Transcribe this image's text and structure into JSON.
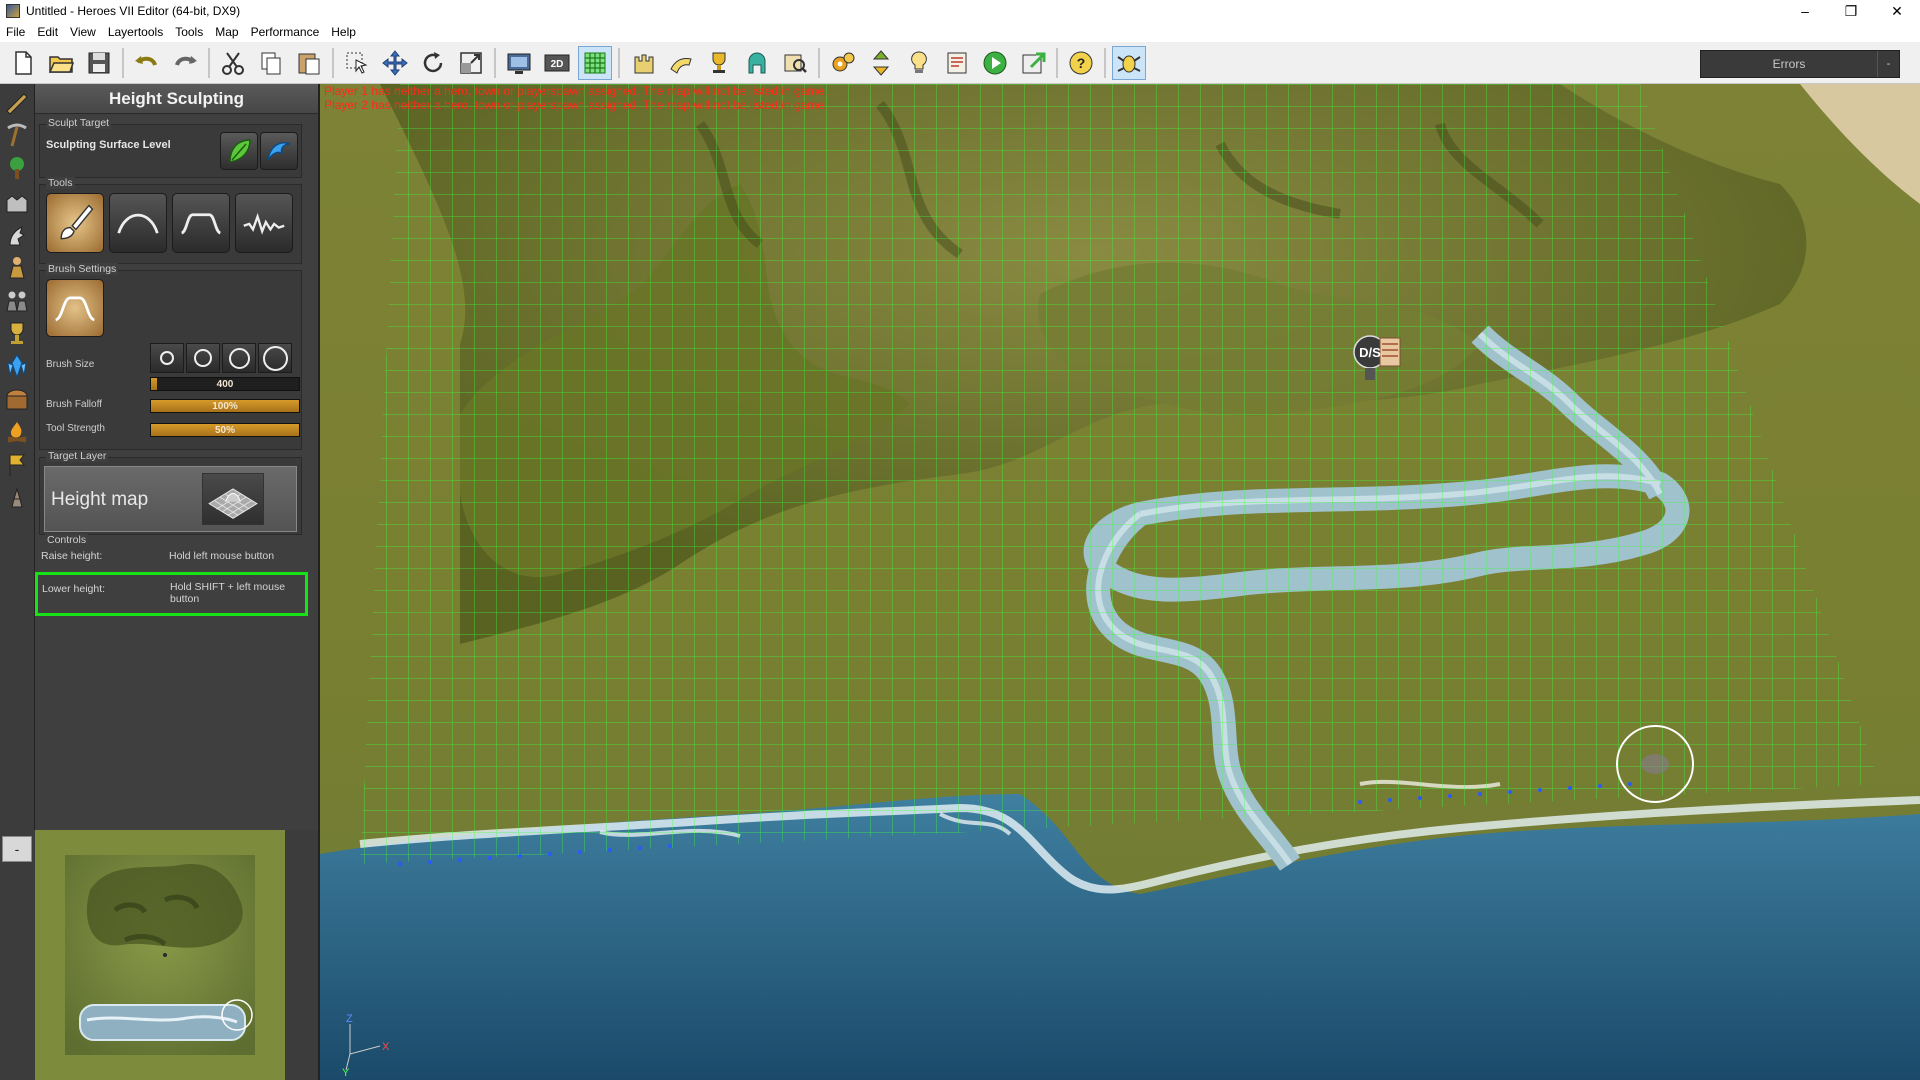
{
  "window": {
    "title": "Untitled - Heroes VII Editor (64-bit, DX9)",
    "minimize": "–",
    "restore": "❐",
    "close": "✕"
  },
  "menu": [
    "File",
    "Edit",
    "View",
    "Layertools",
    "Tools",
    "Map",
    "Performance",
    "Help"
  ],
  "toolbar": {
    "errors_label": "Errors",
    "errors_dropdown": "-"
  },
  "panel": {
    "title": "Height Sculpting",
    "sculpt_target": {
      "group_label": "Sculpt Target",
      "level_label": "Sculpting Surface Level"
    },
    "tools": {
      "group_label": "Tools"
    },
    "brush": {
      "group_label": "Brush Settings",
      "size_label": "Brush Size",
      "size_value": "400",
      "size_fraction": 0.04,
      "falloff_label": "Brush Falloff",
      "falloff_value": "100%",
      "falloff_fraction": 1.0,
      "strength_label": "Tool Strength",
      "strength_value": "50%",
      "strength_fraction": 1.0
    },
    "target_layer": {
      "group_label": "Target Layer",
      "value": "Height map"
    },
    "controls": {
      "group_label": "Controls",
      "raise_key": "Raise height:",
      "raise_value": "Hold left mouse button",
      "lower_key": "Lower height:",
      "lower_value": "Hold SHIFT + left mouse button"
    }
  },
  "minimap": {
    "toggle": "-"
  },
  "viewport": {
    "messages": [
      "Player 1 has neither a hero, town or playerspawn assigned. The map will not be listed in game.",
      "Player 2 has neither a hero, town or playerspawn assigned. The map will not be listed in game."
    ],
    "marker_label": "D/S",
    "axis_z": "Z",
    "axis_x": "X",
    "axis_y": "Y"
  },
  "colors": {
    "highlight": "#17e117",
    "error_text": "#ff2a1a",
    "grid": "#3cff3c"
  }
}
